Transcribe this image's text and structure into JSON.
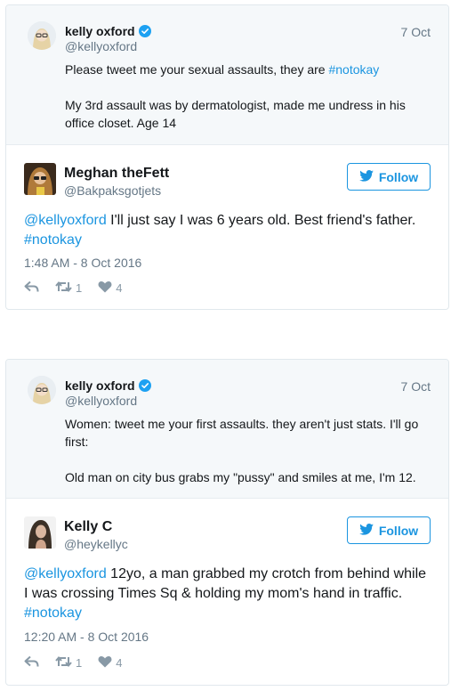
{
  "tweets": [
    {
      "quoted": {
        "name": "kelly oxford",
        "handle": "@kellyoxford",
        "date": "7 Oct",
        "p1_plain": "Please tweet me your sexual assaults, they are ",
        "p1_tag": "#notokay",
        "p2": "My 3rd assault was by dermatologist, made me undress in his office closet. Age 14"
      },
      "reply": {
        "name": "Meghan theFett",
        "handle": "@Bakpaksgotjets",
        "follow_label": "Follow",
        "mention": "@kellyoxford",
        "text": " I'll just say I was 6 years old. Best friend's father.",
        "tag": "#notokay",
        "time": "1:48 AM - 8 Oct 2016",
        "retweets": "1",
        "likes": "4"
      }
    },
    {
      "quoted": {
        "name": "kelly oxford",
        "handle": "@kellyoxford",
        "date": "7 Oct",
        "p1": "Women: tweet me your first assaults. they aren't just stats. I'll go first:",
        "p2": "Old man on city bus grabs my \"pussy\" and smiles at me, I'm 12."
      },
      "reply": {
        "name": "Kelly C",
        "handle": "@heykellyc",
        "follow_label": "Follow",
        "mention": "@kellyoxford",
        "text": " 12yo, a man grabbed my crotch from behind while I was crossing Times Sq & holding my mom's hand in traffic.",
        "tag": "#notokay",
        "time": "12:20 AM - 8 Oct 2016",
        "retweets": "1",
        "likes": "4"
      }
    }
  ],
  "colors": {
    "link": "#1b95e0",
    "muted": "#657786",
    "icon": "#8899a6",
    "border": "#e1e8ed",
    "quoted_bg": "#f5f8fa"
  },
  "icons": [
    "verified-badge-icon",
    "twitter-bird-icon",
    "reply-icon",
    "retweet-icon",
    "heart-icon"
  ]
}
